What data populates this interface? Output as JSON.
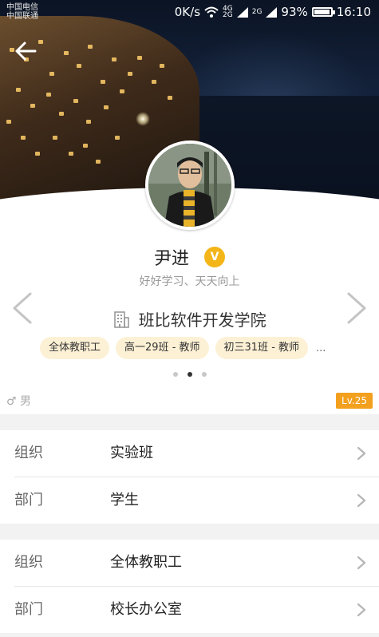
{
  "status_bar": {
    "carrier1": "中国电信",
    "carrier2": "中国联通",
    "speed": "0K/s",
    "net1_top": "4G",
    "net1_bottom": "2G",
    "net2_top": "2G",
    "battery": "93%",
    "time": "16:10"
  },
  "profile": {
    "name": "尹进",
    "verified_badge": "V",
    "motto": "好好学习、天天向上",
    "school": "班比软件开发学院",
    "tags": [
      "全体教职工",
      "高一29班 - 教师",
      "初三31班 - 教师"
    ],
    "tags_more": "...",
    "carousel_active_index": 1,
    "gender_symbol": "♂",
    "gender": "男",
    "level": "Lv.25"
  },
  "sections": [
    {
      "rows": [
        {
          "label": "组织",
          "value": "实验班"
        },
        {
          "label": "部门",
          "value": "学生"
        }
      ]
    },
    {
      "rows": [
        {
          "label": "组织",
          "value": "全体教职工"
        },
        {
          "label": "部门",
          "value": "校长办公室"
        }
      ]
    }
  ],
  "icons": {
    "back": "arrow-left-icon",
    "prev": "chevron-left-icon",
    "next": "chevron-right-icon",
    "building": "building-icon",
    "wifi": "wifi-icon",
    "battery": "battery-icon"
  },
  "colors": {
    "badge": "#f3b517",
    "tag_bg": "#fdf1d5",
    "level_bg": "#f2a01e"
  }
}
